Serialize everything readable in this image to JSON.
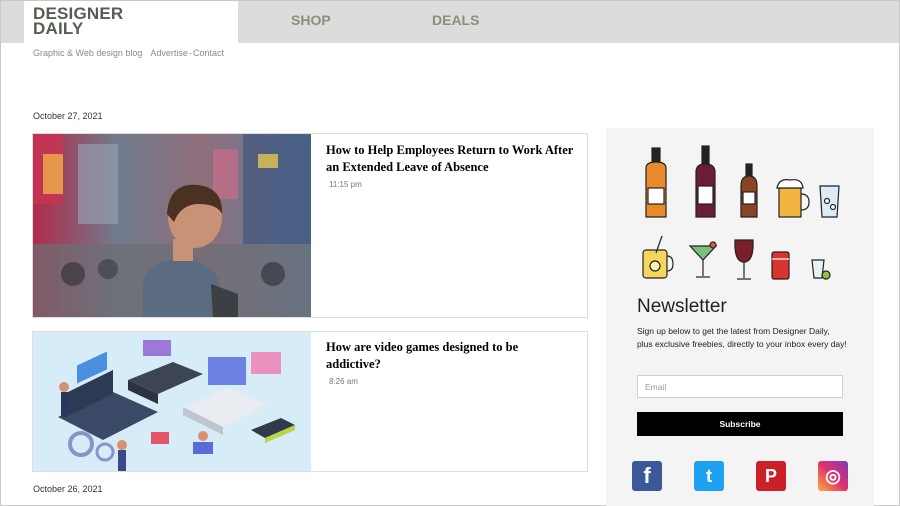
{
  "header": {
    "logo_line1": "DESIGNER",
    "logo_line2": "DAILY",
    "nav": [
      {
        "label": "SHOP"
      },
      {
        "label": "DEALS"
      }
    ],
    "tagline": "Graphic & Web design blog",
    "links": [
      "Advertise",
      "Contact"
    ],
    "link_separator": "-"
  },
  "feed": {
    "date1": "October 27, 2021",
    "date2": "October 26, 2021",
    "posts": [
      {
        "title": "How to Help Employees Return to Work After an Extended Leave of Absence",
        "time": "11:15 pm"
      },
      {
        "title": "How are video games designed to be addictive?",
        "time": "8:26 am"
      }
    ]
  },
  "sidebar": {
    "newsletter_title": "Newsletter",
    "newsletter_text": "Sign up below to get the latest from Designer Daily, plus exclusive freebies, directly to your inbox every day!",
    "email_placeholder": "Email",
    "subscribe_label": "Subscribe",
    "social": [
      {
        "name": "facebook",
        "glyph": "f",
        "color": "#3b5998"
      },
      {
        "name": "twitter",
        "glyph": "t",
        "color": "#1da1f2"
      },
      {
        "name": "pinterest",
        "glyph": "P",
        "color": "#cb2027"
      },
      {
        "name": "instagram",
        "glyph": "◎",
        "color": "#c13584"
      }
    ]
  }
}
